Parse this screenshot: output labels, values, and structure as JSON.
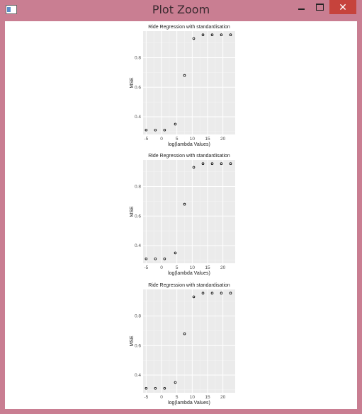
{
  "window": {
    "title": "Plot Zoom",
    "minimize_icon": "minimize-icon",
    "maximize_icon": "maximize-icon",
    "close_icon": "close-icon",
    "close_glyph": "✕",
    "colors": {
      "frame": "#c97e92",
      "close": "#c6433c",
      "panel": "#ebebeb"
    }
  },
  "chart_data": [
    {
      "type": "scatter",
      "title": "Ride Regression with standardisation",
      "xlabel": "log(lambda Values)",
      "ylabel": "MSE",
      "x_ticks": [
        "-5",
        "0",
        "5",
        "10",
        "15",
        "20"
      ],
      "y_ticks": [
        "0.4",
        "0.6",
        "0.8"
      ],
      "xlim": [
        -6,
        24
      ],
      "ylim": [
        0.28,
        0.98
      ],
      "grid": true,
      "x": [
        -5,
        -2,
        1,
        4.5,
        7.5,
        10.5,
        13.5,
        16.5,
        19.5,
        22.5
      ],
      "y": [
        0.31,
        0.31,
        0.31,
        0.35,
        0.68,
        0.93,
        0.955,
        0.955,
        0.955,
        0.955
      ]
    },
    {
      "type": "scatter",
      "title": "Ride Regression with standardisation",
      "xlabel": "log(lambda Values)",
      "ylabel": "MSE",
      "x_ticks": [
        "-5",
        "0",
        "5",
        "10",
        "15",
        "20"
      ],
      "y_ticks": [
        "0.4",
        "0.6",
        "0.8"
      ],
      "xlim": [
        -6,
        24
      ],
      "ylim": [
        0.28,
        0.98
      ],
      "grid": true,
      "x": [
        -5,
        -2,
        1,
        4.5,
        7.5,
        10.5,
        13.5,
        16.5,
        19.5,
        22.5
      ],
      "y": [
        0.31,
        0.31,
        0.31,
        0.35,
        0.68,
        0.93,
        0.955,
        0.955,
        0.955,
        0.955
      ]
    },
    {
      "type": "scatter",
      "title": "Ride Regression with standardisation",
      "xlabel": "log(lambda Values)",
      "ylabel": "MSE",
      "x_ticks": [
        "-5",
        "0",
        "5",
        "10",
        "15",
        "20"
      ],
      "y_ticks": [
        "0.4",
        "0.6",
        "0.8"
      ],
      "xlim": [
        -6,
        24
      ],
      "ylim": [
        0.28,
        0.98
      ],
      "grid": true,
      "x": [
        -5,
        -2,
        1,
        4.5,
        7.5,
        10.5,
        13.5,
        16.5,
        19.5,
        22.5
      ],
      "y": [
        0.31,
        0.31,
        0.31,
        0.35,
        0.68,
        0.93,
        0.955,
        0.955,
        0.955,
        0.955
      ]
    }
  ]
}
